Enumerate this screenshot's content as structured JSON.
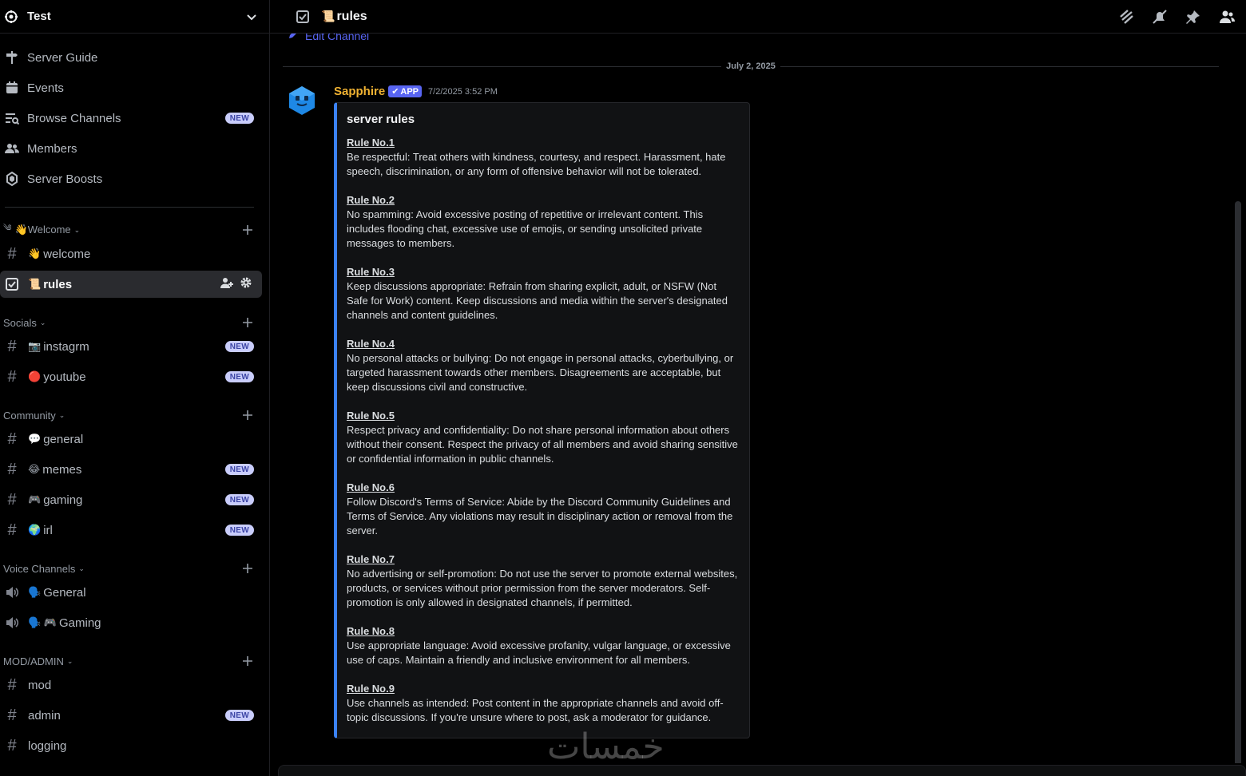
{
  "server": {
    "name": "Test"
  },
  "nav": [
    {
      "label": "Server Guide",
      "icon": "signpost-icon"
    },
    {
      "label": "Events",
      "icon": "calendar-icon"
    },
    {
      "label": "Browse Channels",
      "icon": "browse-channels-icon",
      "badge": "NEW"
    },
    {
      "label": "Members",
      "icon": "members-icon"
    },
    {
      "label": "Server Boosts",
      "icon": "boost-icon"
    }
  ],
  "categories": {
    "welcome": {
      "label": "👋Welcome",
      "prefix": "༄"
    },
    "socials": {
      "label": "Socials"
    },
    "community": {
      "label": "Community"
    },
    "voice": {
      "label": "Voice Channels"
    },
    "admin": {
      "label": "MOD/ADMIN"
    }
  },
  "channels": {
    "welcome": {
      "emoji": "👋",
      "name": "welcome"
    },
    "rules": {
      "emoji": "📜",
      "name": "rules"
    },
    "instagrm": {
      "emoji": "📷",
      "name": "instagrm",
      "badge": "NEW"
    },
    "youtube": {
      "emoji": "🔴",
      "name": "youtube",
      "badge": "NEW"
    },
    "general": {
      "emoji": "💬",
      "name": "general"
    },
    "memes": {
      "emoji": "😂",
      "name": "memes",
      "badge": "NEW"
    },
    "gaming": {
      "emoji": "🎮",
      "name": "gaming",
      "badge": "NEW"
    },
    "irl": {
      "emoji": "🌍",
      "name": "irl",
      "badge": "NEW"
    },
    "voice_general": {
      "emoji": "🗣️",
      "name": "General"
    },
    "voice_gaming": {
      "emoji": "🗣️ 🎮",
      "name": "Gaming"
    },
    "mod": {
      "name": "mod"
    },
    "admin": {
      "name": "admin",
      "badge": "NEW"
    },
    "logging": {
      "name": "logging"
    }
  },
  "topbar": {
    "emoji": "📜",
    "channel": "rules"
  },
  "edit_channel": "Edit Channel",
  "date_separator": "July 2, 2025",
  "message": {
    "author": "Sapphire",
    "tag": "APP",
    "timestamp": "7/2/2025 3:52 PM",
    "embed": {
      "title": "server rules",
      "rules": [
        {
          "title": "Rule No.1",
          "text": "Be respectful: Treat others with kindness, courtesy, and respect. Harassment, hate speech, discrimination, or any form of offensive behavior will not be tolerated."
        },
        {
          "title": "Rule No.2",
          "text": "No spamming: Avoid excessive posting of repetitive or irrelevant content. This includes flooding chat, excessive use of emojis, or sending unsolicited private messages to members."
        },
        {
          "title": "Rule No.3",
          "text": "Keep discussions appropriate: Refrain from sharing explicit, adult, or NSFW (Not Safe for Work) content. Keep discussions and media within the server's designated channels and content guidelines."
        },
        {
          "title": "Rule No.4",
          "text": "No personal attacks or bullying: Do not engage in personal attacks, cyberbullying, or targeted harassment towards other members. Disagreements are acceptable, but keep discussions civil and constructive."
        },
        {
          "title": "Rule No.5",
          "text": "Respect privacy and confidentiality: Do not share personal information about others without their consent. Respect the privacy of all members and avoid sharing sensitive or confidential information in public channels."
        },
        {
          "title": "Rule No.6",
          "text": "Follow Discord's Terms of Service: Abide by the Discord Community Guidelines and Terms of Service. Any violations may result in disciplinary action or removal from the server."
        },
        {
          "title": "Rule No.7",
          "text": "No advertising or self-promotion: Do not use the server to promote external websites, products, or services without prior permission from the server moderators. Self-promotion is only allowed in designated channels, if permitted."
        },
        {
          "title": "Rule No.8",
          "text": "Use appropriate language: Avoid excessive profanity, vulgar language, or excessive use of caps. Maintain a friendly and inclusive environment for all members."
        },
        {
          "title": "Rule No.9",
          "text": "Use channels as intended: Post content in the appropriate channels and avoid off-topic discussions. If you're unsure where to post, ask a moderator for guidance."
        }
      ]
    }
  },
  "watermark": "خمسات",
  "colors": {
    "accent": "#5865f2",
    "author": "#f0b232",
    "embed_border": "#3b82f6",
    "badge_bg": "#c9cdfb"
  }
}
